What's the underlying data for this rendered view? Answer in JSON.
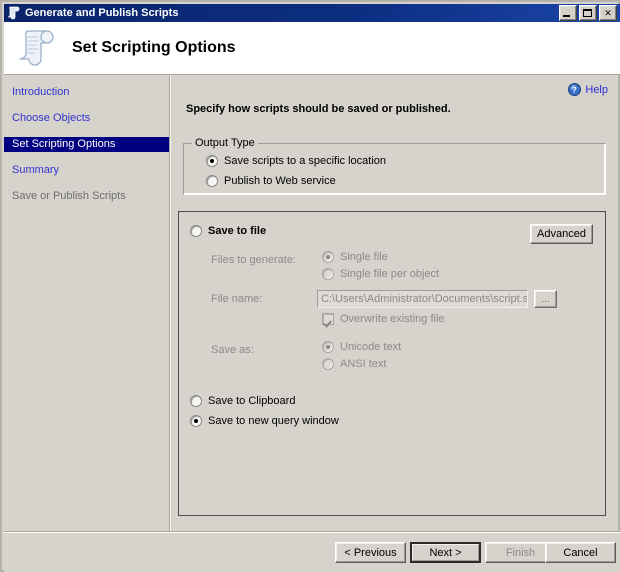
{
  "window": {
    "title": "Generate and Publish Scripts",
    "icon": "script-scroll-icon",
    "controls": {
      "minimize": "minimize",
      "maximize": "maximize",
      "close": "close"
    }
  },
  "header": {
    "title": "Set Scripting Options",
    "icon": "script-scroll-icon"
  },
  "sidebar": {
    "items": [
      {
        "label": "Introduction",
        "state": "link"
      },
      {
        "label": "Choose Objects",
        "state": "link"
      },
      {
        "label": "Set Scripting Options",
        "state": "active"
      },
      {
        "label": "Summary",
        "state": "link"
      },
      {
        "label": "Save or Publish Scripts",
        "state": "disabled"
      }
    ]
  },
  "content": {
    "help": {
      "label": "Help",
      "icon": "help-circle-icon"
    },
    "instruction": "Specify how scripts should be saved or published.",
    "output_type": {
      "legend": "Output Type",
      "options": [
        {
          "label": "Save scripts to a specific location",
          "checked": true
        },
        {
          "label": "Publish to Web service",
          "checked": false
        }
      ]
    },
    "save_panel": {
      "save_to_file": {
        "label": "Save to file",
        "checked": false
      },
      "advanced_button": "Advanced",
      "files_to_generate": {
        "label": "Files to generate:",
        "options": [
          {
            "label": "Single file",
            "checked": true
          },
          {
            "label": "Single file per object",
            "checked": false
          }
        ]
      },
      "file_name": {
        "label": "File name:",
        "value": "C:\\Users\\Administrator\\Documents\\script.sql",
        "browse_button": "..."
      },
      "overwrite": {
        "label": "Overwrite existing file",
        "checked": true
      },
      "save_as": {
        "label": "Save as:",
        "options": [
          {
            "label": "Unicode text",
            "checked": true
          },
          {
            "label": "ANSI text",
            "checked": false
          }
        ]
      },
      "save_to_clipboard": {
        "label": "Save to Clipboard",
        "checked": false
      },
      "save_to_new_query_window": {
        "label": "Save to new query window",
        "checked": true
      }
    }
  },
  "footer": {
    "buttons": [
      {
        "label": "< Previous",
        "state": "enabled",
        "accel": "P"
      },
      {
        "label": "Next >",
        "state": "default",
        "accel": "N"
      },
      {
        "label": "Finish",
        "state": "disabled",
        "accel": "F"
      },
      {
        "label": "Cancel",
        "state": "enabled",
        "accel": ""
      }
    ]
  },
  "colors": {
    "titlebar": "#0a246a",
    "dialog_bg": "#d6d3cd",
    "header_bg": "#ffffff",
    "link": "#3333cc",
    "active_nav_bg": "#000080",
    "disabled_text": "#8c8a85"
  }
}
